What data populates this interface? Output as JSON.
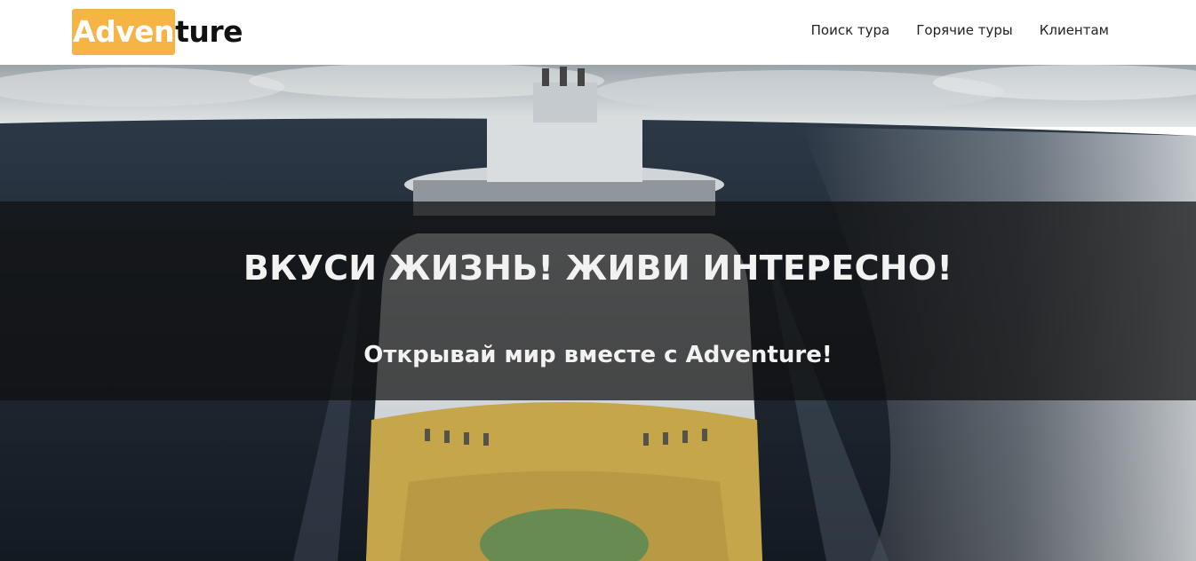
{
  "brand": {
    "logo_highlight": "Adven",
    "logo_rest": "ture",
    "accent_color": "#f6b445"
  },
  "nav": {
    "items": [
      {
        "label": "Поиск тура"
      },
      {
        "label": "Горячие туры"
      },
      {
        "label": "Клиентам"
      }
    ]
  },
  "hero": {
    "title": "ВКУСИ ЖИЗНЬ! ЖИВИ ИНТЕРЕСНО!",
    "subtitle": "Открывай мир вместе с Adventure!"
  }
}
